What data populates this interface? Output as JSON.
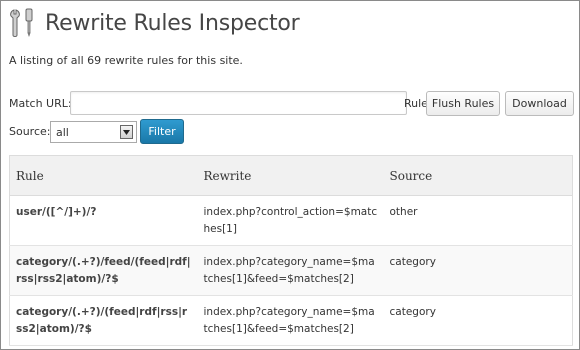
{
  "page": {
    "title": "Rewrite Rules Inspector",
    "intro": "A listing of all 69 rewrite rules for this site."
  },
  "match": {
    "label": "Match URL:",
    "value": "",
    "placeholder": "",
    "trailing_label": "Rule",
    "flush_label": "Flush Rules",
    "download_label": "Download"
  },
  "source": {
    "label": "Source:",
    "selected": "all",
    "filter_label": "Filter"
  },
  "table": {
    "headers": {
      "rule": "Rule",
      "rewrite": "Rewrite",
      "source": "Source"
    },
    "rows": [
      {
        "rule": "user/([^/]+)/?",
        "rewrite": "index.php?control_action=$matches[1]",
        "source": "other"
      },
      {
        "rule": "category/(.+?)/feed/(feed|rdf|rss|rss2|atom)/?$",
        "rewrite": "index.php?category_name=$matches[1]&feed=$matches[2]",
        "source": "category"
      },
      {
        "rule": "category/(.+?)/(feed|rdf|rss|rss2|atom)/?$",
        "rewrite": "index.php?category_name=$matches[1]&feed=$matches[2]",
        "source": "category"
      }
    ]
  },
  "icons": {
    "header": "tools-icon",
    "select_arrow": "chevron-down-icon"
  }
}
